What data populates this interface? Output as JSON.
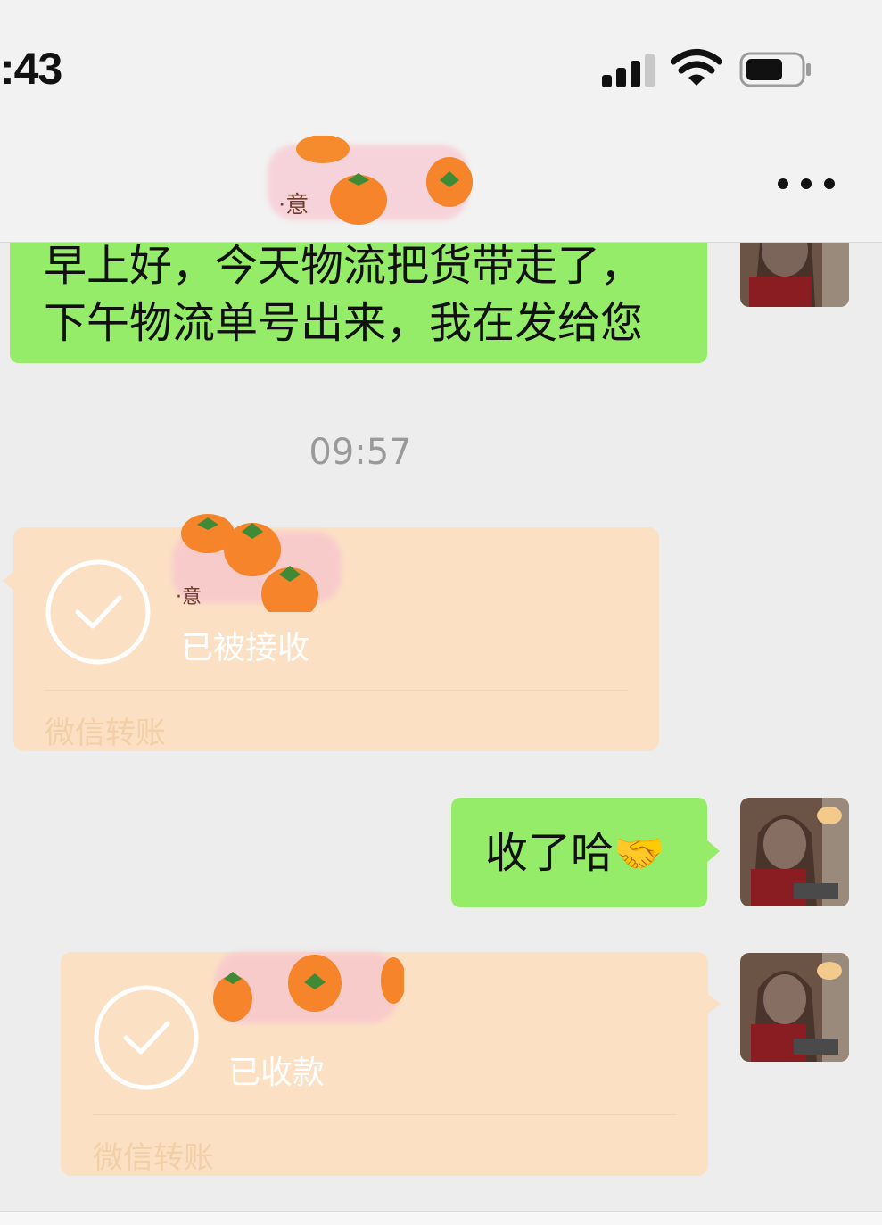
{
  "status_bar": {
    "time": ":43"
  },
  "nav": {
    "more_label": "..."
  },
  "messages": {
    "first": {
      "line1": "早上好，今天物流把货带走了，",
      "line2": "下午物流单号出来，我在发给您"
    },
    "timestamp": "09:57",
    "transfer_received": {
      "status": "已被接收",
      "footer": "微信转账"
    },
    "reply": {
      "text": "收了哈",
      "emoji": "🤝"
    },
    "transfer_collected": {
      "status": "已收款",
      "footer": "微信转账"
    }
  },
  "colors": {
    "outgoing_bubble": "#95ec69",
    "transfer_bubble": "#fbe0c4",
    "background": "#ededed"
  },
  "icons": [
    "signal-icon",
    "wifi-icon",
    "battery-icon",
    "more-icon",
    "check-circle-icon",
    "persimmon-sticker",
    "avatar"
  ]
}
